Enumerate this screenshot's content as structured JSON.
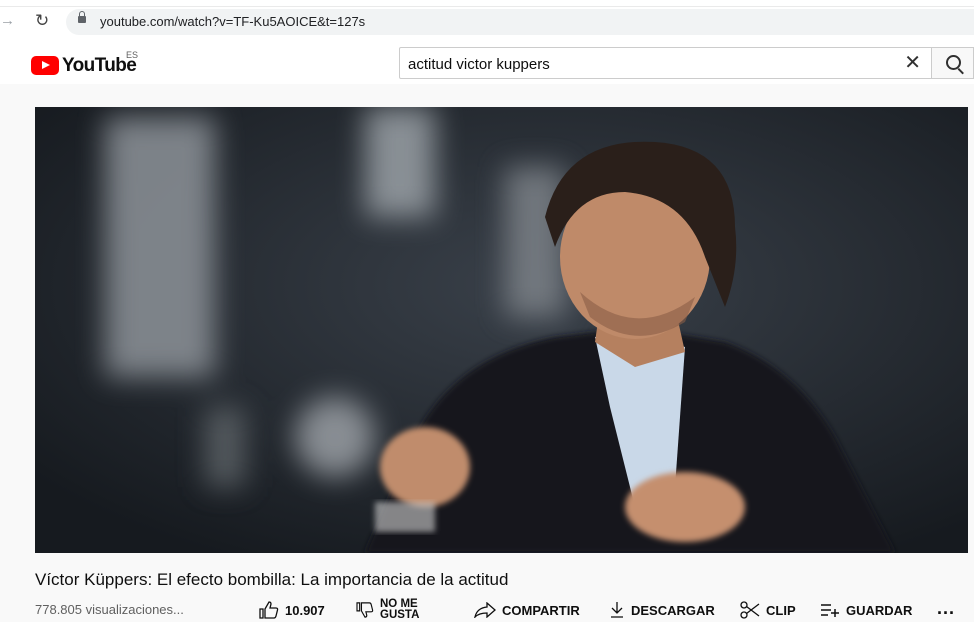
{
  "browser": {
    "url": "youtube.com/watch?v=TF-Ku5AOICE&t=127s"
  },
  "header": {
    "logo_text": "YouTube",
    "region": "ES",
    "search_value": "actitud victor kuppers",
    "clear_icon": "close-icon",
    "search_icon": "search-icon"
  },
  "video": {
    "title": "Víctor Küppers: El efecto bombilla: La importancia de la actitud",
    "views": "778.805 visualizaciones...",
    "like_count": "10.907",
    "dislike_line1": "NO ME",
    "dislike_line2": "GUSTA",
    "share_label": "COMPARTIR",
    "download_label": "DESCARGAR",
    "clip_label": "CLIP",
    "save_label": "GUARDAR",
    "more_label": "..."
  },
  "colors": {
    "brand_red": "#ff0000",
    "text_secondary": "#606060"
  }
}
